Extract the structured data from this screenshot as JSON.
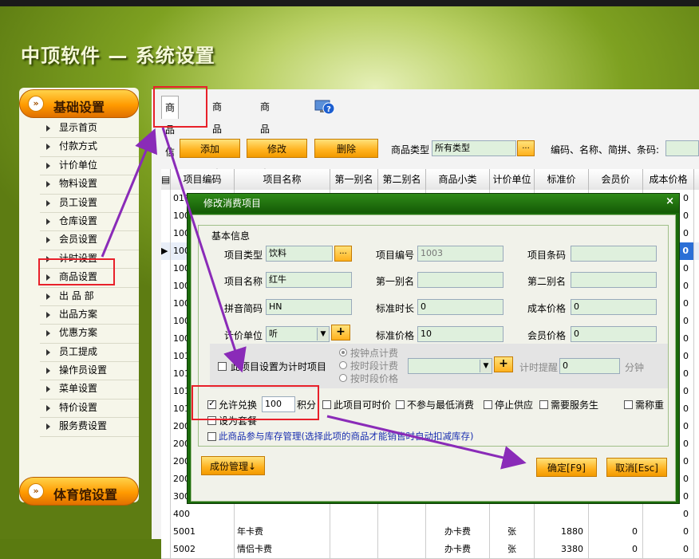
{
  "app": {
    "title": "中顶软件 — 系统设置"
  },
  "sidebar": {
    "section_basic": "基础设置",
    "section_gym": "体育馆设置",
    "items": [
      {
        "label": "显示首页"
      },
      {
        "label": "付款方式"
      },
      {
        "label": "计价单位"
      },
      {
        "label": "物料设置"
      },
      {
        "label": "员工设置"
      },
      {
        "label": "仓库设置"
      },
      {
        "label": "会员设置"
      },
      {
        "label": "计时设置"
      },
      {
        "label": "商品设置"
      },
      {
        "label": "出 品 部"
      },
      {
        "label": "出品方案"
      },
      {
        "label": "优惠方案"
      },
      {
        "label": "员工提成"
      },
      {
        "label": "操作员设置"
      },
      {
        "label": "菜单设置"
      },
      {
        "label": "特价设置"
      },
      {
        "label": "服务费设置"
      }
    ]
  },
  "tabs": [
    {
      "label": "商品信息"
    },
    {
      "label": "商品大类"
    },
    {
      "label": "商品小类"
    }
  ],
  "toolbar": {
    "add": "添加",
    "edit": "修改",
    "delete": "删除",
    "type_label": "商品类型",
    "type_value": "所有类型",
    "dots": "...",
    "search_label": "编码、名称、简拼、条码:"
  },
  "table": {
    "columns": [
      "项目编码",
      "项目名称",
      "第一别名",
      "第二别名",
      "商品小类",
      "计价单位",
      "标准价",
      "会员价",
      "成本价格"
    ],
    "rows": [
      {
        "code": "010",
        "name": "",
        "alias1": "",
        "alias2": "",
        "sub": "",
        "unit": "",
        "price": "",
        "member": "",
        "cost": "0"
      },
      {
        "code": "100",
        "name": "",
        "alias1": "",
        "alias2": "",
        "sub": "",
        "unit": "",
        "price": "",
        "member": "",
        "cost": "0"
      },
      {
        "code": "100",
        "name": "",
        "alias1": "",
        "alias2": "",
        "sub": "",
        "unit": "",
        "price": "",
        "member": "",
        "cost": "0"
      },
      {
        "code": "100",
        "name": "",
        "alias1": "",
        "alias2": "",
        "sub": "",
        "unit": "",
        "price": "",
        "member": "",
        "cost": "0"
      },
      {
        "code": "100",
        "name": "",
        "alias1": "",
        "alias2": "",
        "sub": "",
        "unit": "",
        "price": "",
        "member": "",
        "cost": "0"
      },
      {
        "code": "100",
        "name": "",
        "alias1": "",
        "alias2": "",
        "sub": "",
        "unit": "",
        "price": "",
        "member": "",
        "cost": "0"
      },
      {
        "code": "100",
        "name": "",
        "alias1": "",
        "alias2": "",
        "sub": "",
        "unit": "",
        "price": "",
        "member": "",
        "cost": "0"
      },
      {
        "code": "100",
        "name": "",
        "alias1": "",
        "alias2": "",
        "sub": "",
        "unit": "",
        "price": "",
        "member": "",
        "cost": "0"
      },
      {
        "code": "100",
        "name": "",
        "alias1": "",
        "alias2": "",
        "sub": "",
        "unit": "",
        "price": "",
        "member": "",
        "cost": "0"
      },
      {
        "code": "101",
        "name": "",
        "alias1": "",
        "alias2": "",
        "sub": "",
        "unit": "",
        "price": "",
        "member": "",
        "cost": "0"
      },
      {
        "code": "101",
        "name": "",
        "alias1": "",
        "alias2": "",
        "sub": "",
        "unit": "",
        "price": "",
        "member": "",
        "cost": "0"
      },
      {
        "code": "101",
        "name": "",
        "alias1": "",
        "alias2": "",
        "sub": "",
        "unit": "",
        "price": "",
        "member": "",
        "cost": "0"
      },
      {
        "code": "101",
        "name": "",
        "alias1": "",
        "alias2": "",
        "sub": "",
        "unit": "",
        "price": "",
        "member": "",
        "cost": "0"
      },
      {
        "code": "200",
        "name": "",
        "alias1": "",
        "alias2": "",
        "sub": "",
        "unit": "",
        "price": "",
        "member": "",
        "cost": "0"
      },
      {
        "code": "200",
        "name": "",
        "alias1": "",
        "alias2": "",
        "sub": "",
        "unit": "",
        "price": "",
        "member": "",
        "cost": "0"
      },
      {
        "code": "200",
        "name": "",
        "alias1": "",
        "alias2": "",
        "sub": "",
        "unit": "",
        "price": "",
        "member": "",
        "cost": "0"
      },
      {
        "code": "200",
        "name": "",
        "alias1": "",
        "alias2": "",
        "sub": "",
        "unit": "",
        "price": "",
        "member": "",
        "cost": "0"
      },
      {
        "code": "300",
        "name": "",
        "alias1": "",
        "alias2": "",
        "sub": "",
        "unit": "",
        "price": "",
        "member": "",
        "cost": "0"
      },
      {
        "code": "400",
        "name": "",
        "alias1": "",
        "alias2": "",
        "sub": "",
        "unit": "",
        "price": "",
        "member": "",
        "cost": "0"
      },
      {
        "code": "5001",
        "name": "年卡费",
        "alias1": "",
        "alias2": "",
        "sub": "办卡费",
        "unit": "张",
        "price": "1880",
        "member": "0",
        "cost": "0"
      },
      {
        "code": "5002",
        "name": "情侣卡费",
        "alias1": "",
        "alias2": "",
        "sub": "办卡费",
        "unit": "张",
        "price": "3380",
        "member": "0",
        "cost": "0"
      }
    ],
    "selected_cost": "0"
  },
  "dialog": {
    "title": "修改消费项目",
    "close": "×",
    "group": "基本信息",
    "type_label": "项目类型",
    "type_value": "饮料",
    "code_label": "项目编号",
    "code_value": "1003",
    "barcode_label": "项目条码",
    "barcode_value": "",
    "name_label": "项目名称",
    "name_value": "红牛",
    "alias1_label": "第一别名",
    "alias1_value": "",
    "alias2_label": "第二别名",
    "alias2_value": "",
    "pinyin_label": "拼音简码",
    "pinyin_value": "HN",
    "std_time_label": "标准时长",
    "std_time_value": "0",
    "cost_label": "成本价格",
    "cost_value": "0",
    "unit_label": "计价单位",
    "unit_value": "听",
    "std_price_label": "标准价格",
    "std_price_value": "10",
    "member_price_label": "会员价格",
    "member_price_value": "0",
    "timing_label": "此项目设置为计时项目",
    "radio_point": "按钟点计费",
    "radio_period": "按时段计费",
    "radio_period_price": "按时段价格",
    "timer_alert_label": "计时提醒",
    "timer_alert_value": "0",
    "timer_unit": "分钟",
    "allow_exchange_label": "允许兑换",
    "points_value": "100",
    "points_unit": "积分",
    "opt_timed_price": "此项目可时价",
    "opt_no_min": "不参与最低消费",
    "opt_stop": "停止供应",
    "opt_service": "需要服务生",
    "opt_weigh": "需称重",
    "opt_package": "设为套餐",
    "opt_stock": "此商品参与库存管理(选择此项的商品才能销售时自动扣减库存)",
    "component_btn": "成份管理↓",
    "ok_btn": "确定[F9]",
    "cancel_btn": "取消[Esc]"
  },
  "colors": {
    "accent_orange": "#ffb11d",
    "dialog_green": "#1b6b0b",
    "highlight_red": "#e8202a",
    "arrow_purple": "#8a2bb8"
  }
}
